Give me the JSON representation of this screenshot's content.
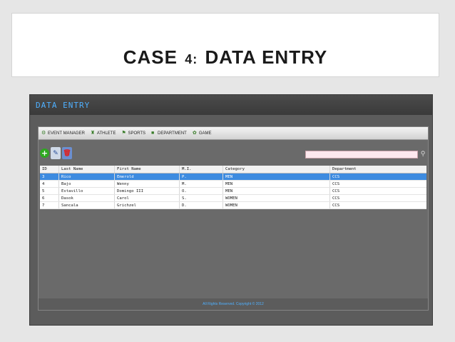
{
  "slide": {
    "title_prefix": "CASE",
    "title_number": "4:",
    "title_suffix": "DATA ENTRY"
  },
  "app": {
    "window_title": "DATA ENTRY",
    "menu": [
      {
        "label": "EVENT MANAGER",
        "icon": "event-icon"
      },
      {
        "label": "ATHLETE",
        "icon": "athlete-icon"
      },
      {
        "label": "SPORTS",
        "icon": "sports-icon"
      },
      {
        "label": "DEPARTMENT",
        "icon": "department-icon"
      },
      {
        "label": "GAME",
        "icon": "game-icon"
      }
    ],
    "toolbar": {
      "add_icon": "+",
      "edit_icon": "✎",
      "delete_icon": "🗑"
    },
    "search": {
      "value": "",
      "placeholder": ""
    },
    "table": {
      "columns": [
        "ID",
        "Last Name",
        "First Name",
        "M.I.",
        "Category",
        "Department"
      ],
      "rows": [
        {
          "id": "3",
          "last": "Rico",
          "first": "Emerold",
          "mi": "P.",
          "category": "MEN",
          "dept": "CCS",
          "selected": true
        },
        {
          "id": "4",
          "last": "Bajo",
          "first": "Wenny",
          "mi": "M.",
          "category": "MEN",
          "dept": "CCS",
          "selected": false
        },
        {
          "id": "5",
          "last": "Estavillo",
          "first": "Domingo III",
          "mi": "O.",
          "category": "MEN",
          "dept": "CCS",
          "selected": false
        },
        {
          "id": "6",
          "last": "Dasok",
          "first": "Carol",
          "mi": "S.",
          "category": "WOMEN",
          "dept": "CCS",
          "selected": false
        },
        {
          "id": "7",
          "last": "Sancala",
          "first": "Grichzel",
          "mi": "D.",
          "category": "WOMEN",
          "dept": "CCS",
          "selected": false
        }
      ]
    },
    "footer": "All Rights Reserved. Copyright © 2012",
    "colors": {
      "accent_blue": "#4fb0ff",
      "selected_row": "#3d8be0"
    }
  }
}
